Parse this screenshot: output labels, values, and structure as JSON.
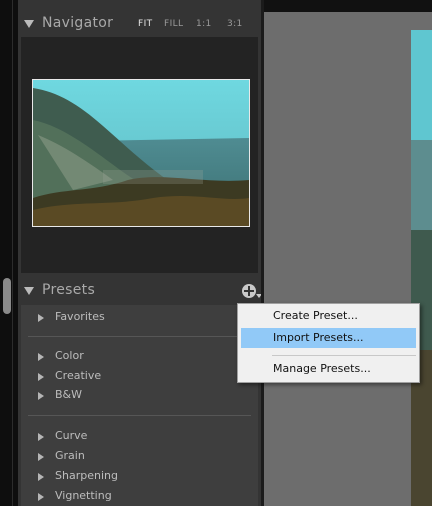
{
  "navigator": {
    "title": "Navigator",
    "options": [
      "FIT",
      "FILL",
      "1:1",
      "3:1"
    ],
    "active_option": "FIT"
  },
  "presets": {
    "title": "Presets",
    "groups": [
      [
        "Favorites"
      ],
      [
        "Color",
        "Creative",
        "B&W"
      ],
      [
        "Curve",
        "Grain",
        "Sharpening",
        "Vignetting"
      ]
    ]
  },
  "context_menu": {
    "items": [
      "Create Preset...",
      "Import Presets...",
      "Manage Presets..."
    ],
    "highlighted": "Import Presets..."
  },
  "colors": {
    "panel": "#343434",
    "highlight": "#91c9f7",
    "canvas": "#6d6d6d"
  },
  "icons": [
    "expand-triangle-icon",
    "add-preset-icon",
    "disclosure-triangle-icon",
    "dropdown-caret-icon"
  ]
}
